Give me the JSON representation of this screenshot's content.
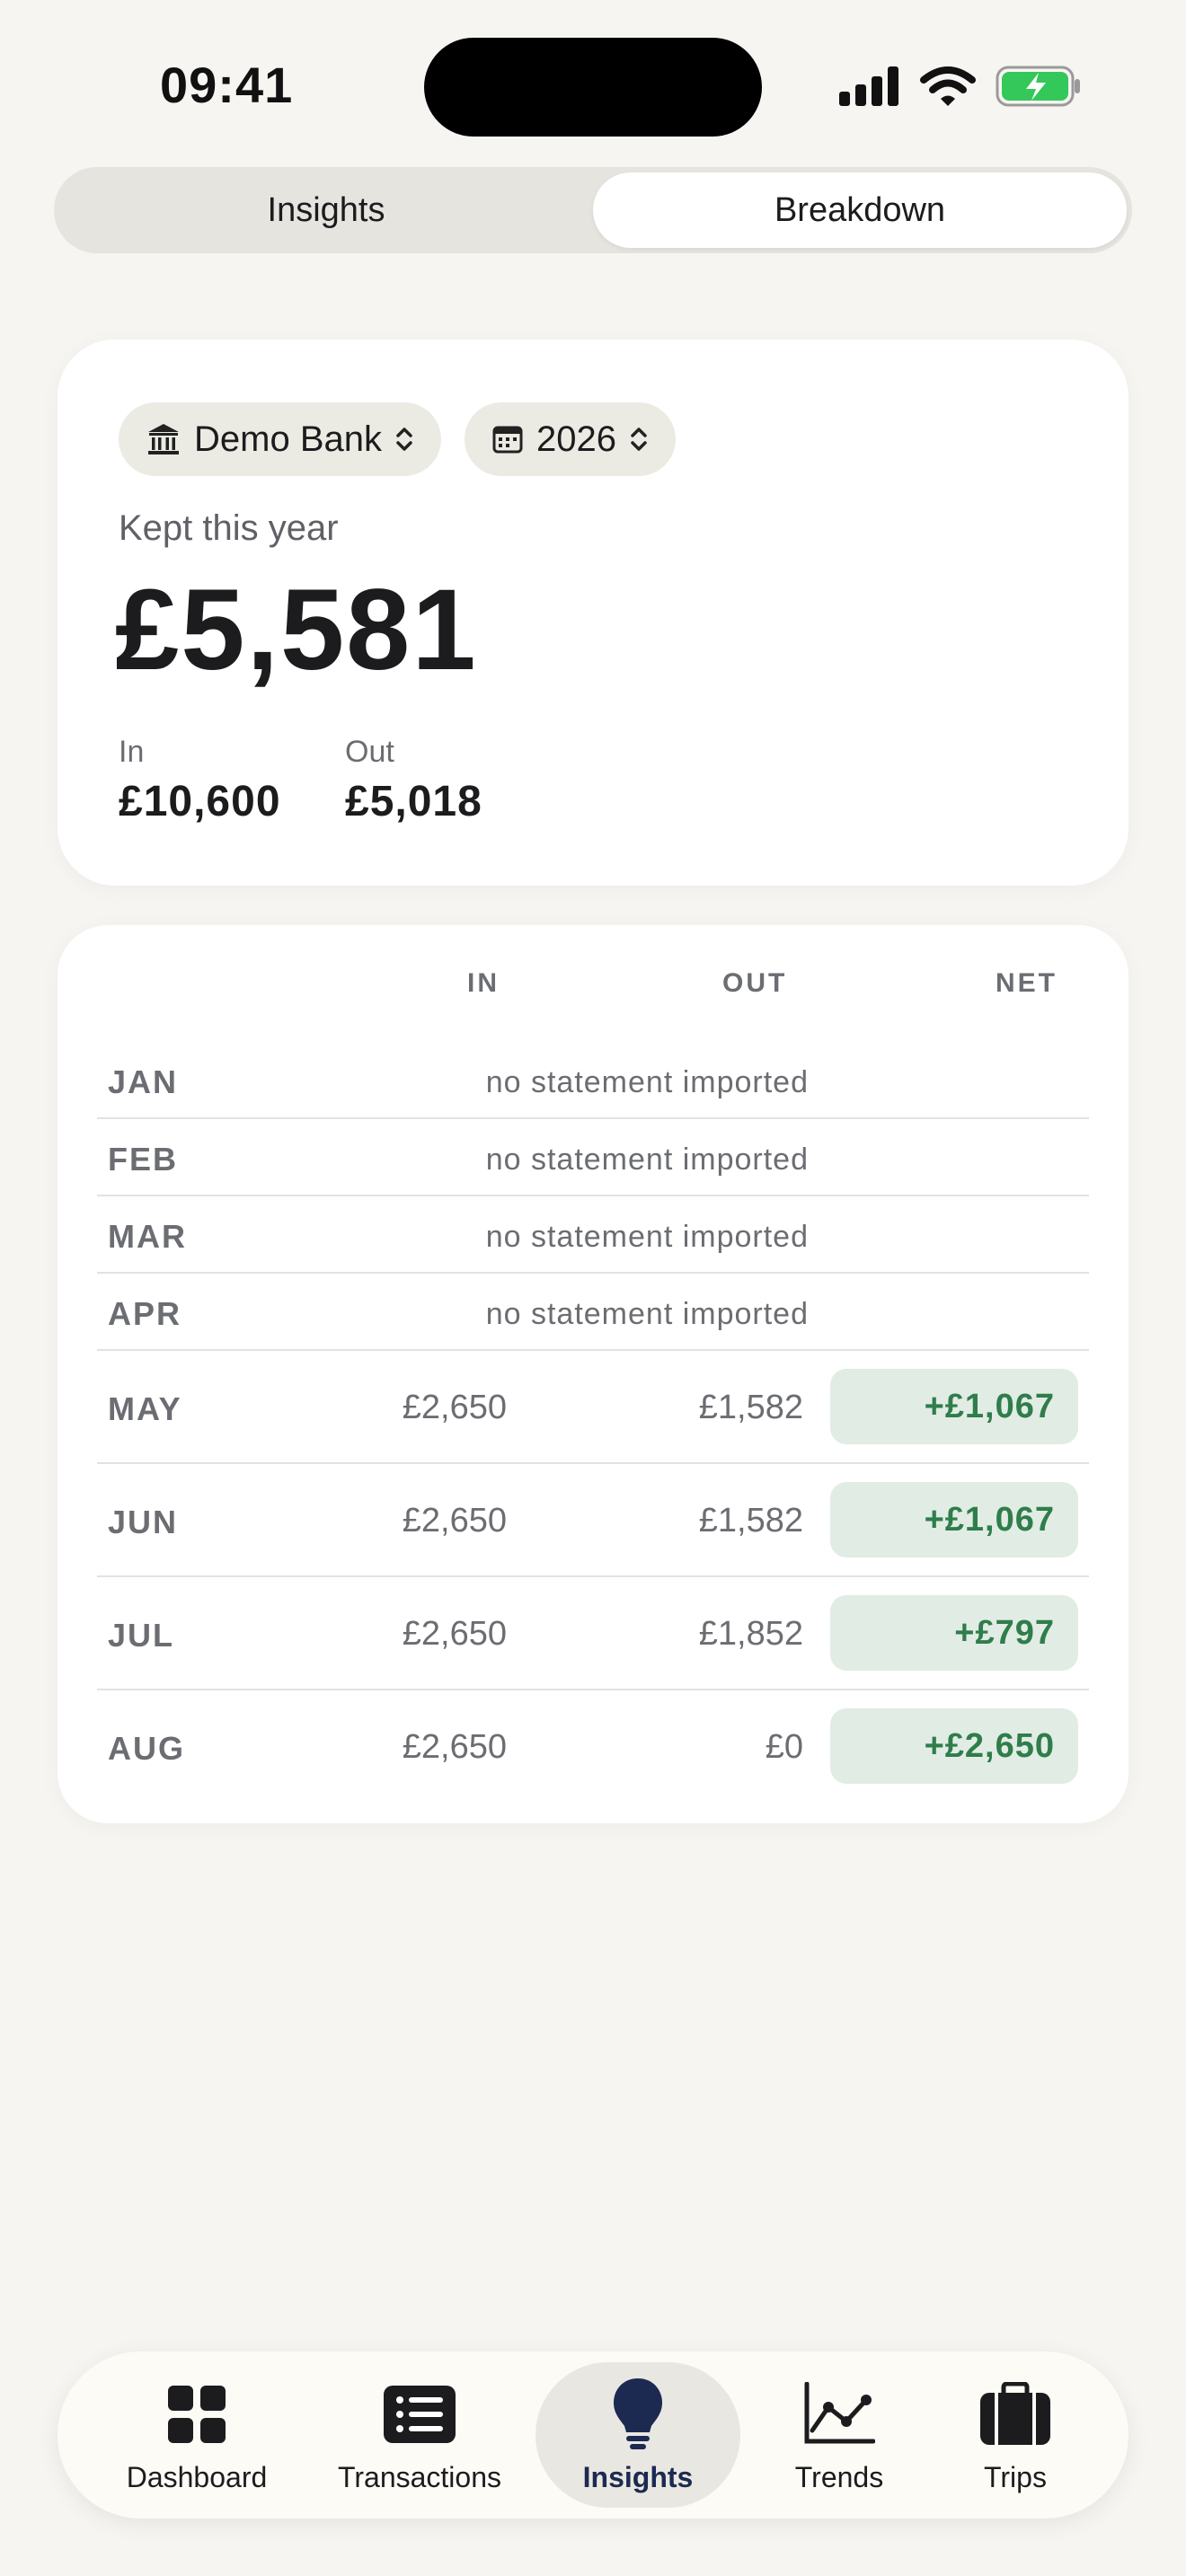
{
  "status_bar": {
    "time": "09:41"
  },
  "segmented": {
    "insights": "Insights",
    "breakdown": "Breakdown"
  },
  "summary": {
    "bank": "Demo Bank",
    "year": "2026",
    "kept_label": "Kept this year",
    "kept_value": "£5,581",
    "in_label": "In",
    "in_value": "£10,600",
    "out_label": "Out",
    "out_value": "£5,018"
  },
  "table": {
    "headers": {
      "in": "IN",
      "out": "OUT",
      "net": "NET"
    },
    "rows": [
      {
        "month": "JAN",
        "note": "no statement imported"
      },
      {
        "month": "FEB",
        "note": "no statement imported"
      },
      {
        "month": "MAR",
        "note": "no statement imported"
      },
      {
        "month": "APR",
        "note": "no statement imported"
      },
      {
        "month": "MAY",
        "in": "£2,650",
        "out": "£1,582",
        "net": "+£1,067"
      },
      {
        "month": "JUN",
        "in": "£2,650",
        "out": "£1,582",
        "net": "+£1,067"
      },
      {
        "month": "JUL",
        "in": "£2,650",
        "out": "£1,852",
        "net": "+£797"
      },
      {
        "month": "AUG",
        "in": "£2,650",
        "out": "£0",
        "net": "+£2,650"
      }
    ]
  },
  "tabbar": {
    "dashboard": "Dashboard",
    "transactions": "Transactions",
    "insights": "Insights",
    "trends": "Trends",
    "trips": "Trips"
  },
  "colors": {
    "background": "#f6f5f1",
    "positive": "#2f7d4b",
    "positive_bg": "#e1ece4",
    "active_tab": "#1c2a52",
    "battery": "#34c759"
  }
}
